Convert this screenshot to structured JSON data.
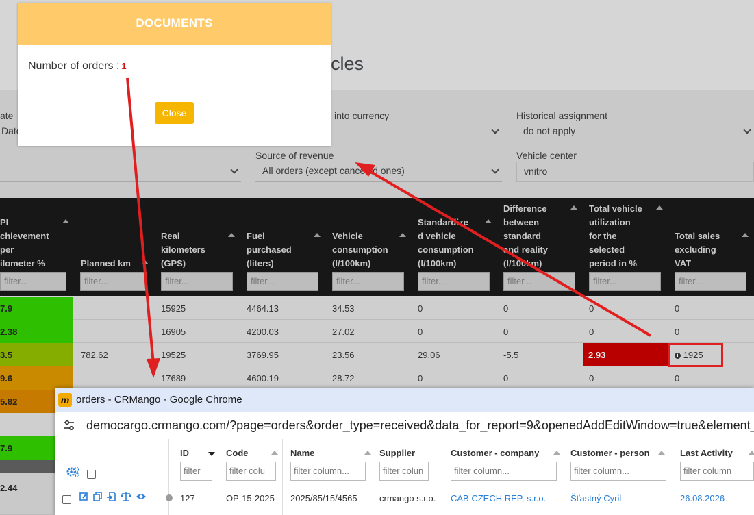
{
  "page": {
    "heading_fragment": "cles"
  },
  "filters": {
    "date_label_fragment": "ate",
    "date_value_fragment": "Date",
    "currency_label_fragment": "into currency",
    "historical_label": "Historical assignment",
    "historical_value": "do not apply",
    "source_label": "Source of revenue",
    "source_value": "All orders (except canceled ones)",
    "vehicle_center_label": "Vehicle center",
    "vehicle_center_value": "vnitro"
  },
  "table": {
    "headers": {
      "kpi": [
        "PI",
        "chievement",
        "per",
        "ilometer %"
      ],
      "planned": [
        "Planned km"
      ],
      "real": [
        "Real",
        "kilometers",
        "(GPS)"
      ],
      "fuel": [
        "Fuel",
        "purchased",
        "(liters)"
      ],
      "consumption": [
        "Vehicle",
        "consumption",
        " (l/100km)"
      ],
      "standardized": [
        "Standardize",
        "d vehicle",
        "consumption",
        " (l/100km)"
      ],
      "difference": [
        "Difference",
        "between",
        "standard",
        "and reality",
        "(l/100km)"
      ],
      "utilization": [
        "Total vehicle",
        "utilization",
        "for the",
        "selected",
        "period in %"
      ],
      "sales": [
        "Total sales",
        "excluding",
        "VAT"
      ]
    },
    "filter_placeholder": "filter...",
    "rows": [
      {
        "kpi": "7.9",
        "planned": "",
        "real": "15925",
        "fuel": "4464.13",
        "cons": "34.53",
        "std": "0",
        "diff": "0",
        "util": "0",
        "sales": "0"
      },
      {
        "kpi": "2.38",
        "planned": "",
        "real": "16905",
        "fuel": "4200.03",
        "cons": "27.02",
        "std": "0",
        "diff": "0",
        "util": "0",
        "sales": "0"
      },
      {
        "kpi": "3.5",
        "planned": "782.62",
        "real": "19525",
        "fuel": "3769.95",
        "cons": "23.56",
        "std": "29.06",
        "diff": "-5.5",
        "util": "2.93",
        "sales": "1925"
      },
      {
        "kpi": "9.6",
        "planned": "",
        "real": "17689",
        "fuel": "4600.19",
        "cons": "28.72",
        "std": "0",
        "diff": "0",
        "util": "0",
        "sales": "0"
      },
      {
        "kpi": "5.82"
      },
      {
        "kpi": ""
      },
      {
        "kpi": "7.9"
      },
      {
        "kpi": ""
      },
      {
        "kpi": "2.44"
      }
    ]
  },
  "colors": {
    "kpi_green": "#2ec000",
    "kpi_olive": "#84ad00",
    "kpi_orange": "#c98a00",
    "kpi_dark_orange": "#c77a00",
    "modal_header": "#ffca6a",
    "close_button": "#f6b600",
    "alert_red": "#b80000"
  },
  "modal": {
    "title": "DOCUMENTS",
    "count_label": "Number of orders :",
    "count_value": "1",
    "close_label": "Close"
  },
  "chrome": {
    "title": "orders - CRMango - Google Chrome",
    "url": "democargo.crmango.com/?page=orders&order_type=received&data_for_report=9&openedAddEditWindow=true&element_tr",
    "columns": {
      "id": "ID",
      "code": "Code",
      "name": "Name",
      "supplier": "Supplier",
      "customer_company": "Customer - company",
      "customer_person": "Customer - person",
      "last_activity": "Last Activity"
    },
    "filters": {
      "id": "filter",
      "code": "filter colu",
      "name": "filter column...",
      "supplier": "filter colun",
      "customer_company": "filter column...",
      "customer_person": "filter column...",
      "last_activity": "filter column"
    },
    "row": {
      "id": "127",
      "code": "OP-15-2025",
      "name": "2025/85/15/4565",
      "supplier": "crmango s.r.o.",
      "customer_company": "CAB CZECH REP, s.r.o.",
      "customer_person": "Šťastný Cyril",
      "last_activity": "26.08.2026"
    }
  }
}
